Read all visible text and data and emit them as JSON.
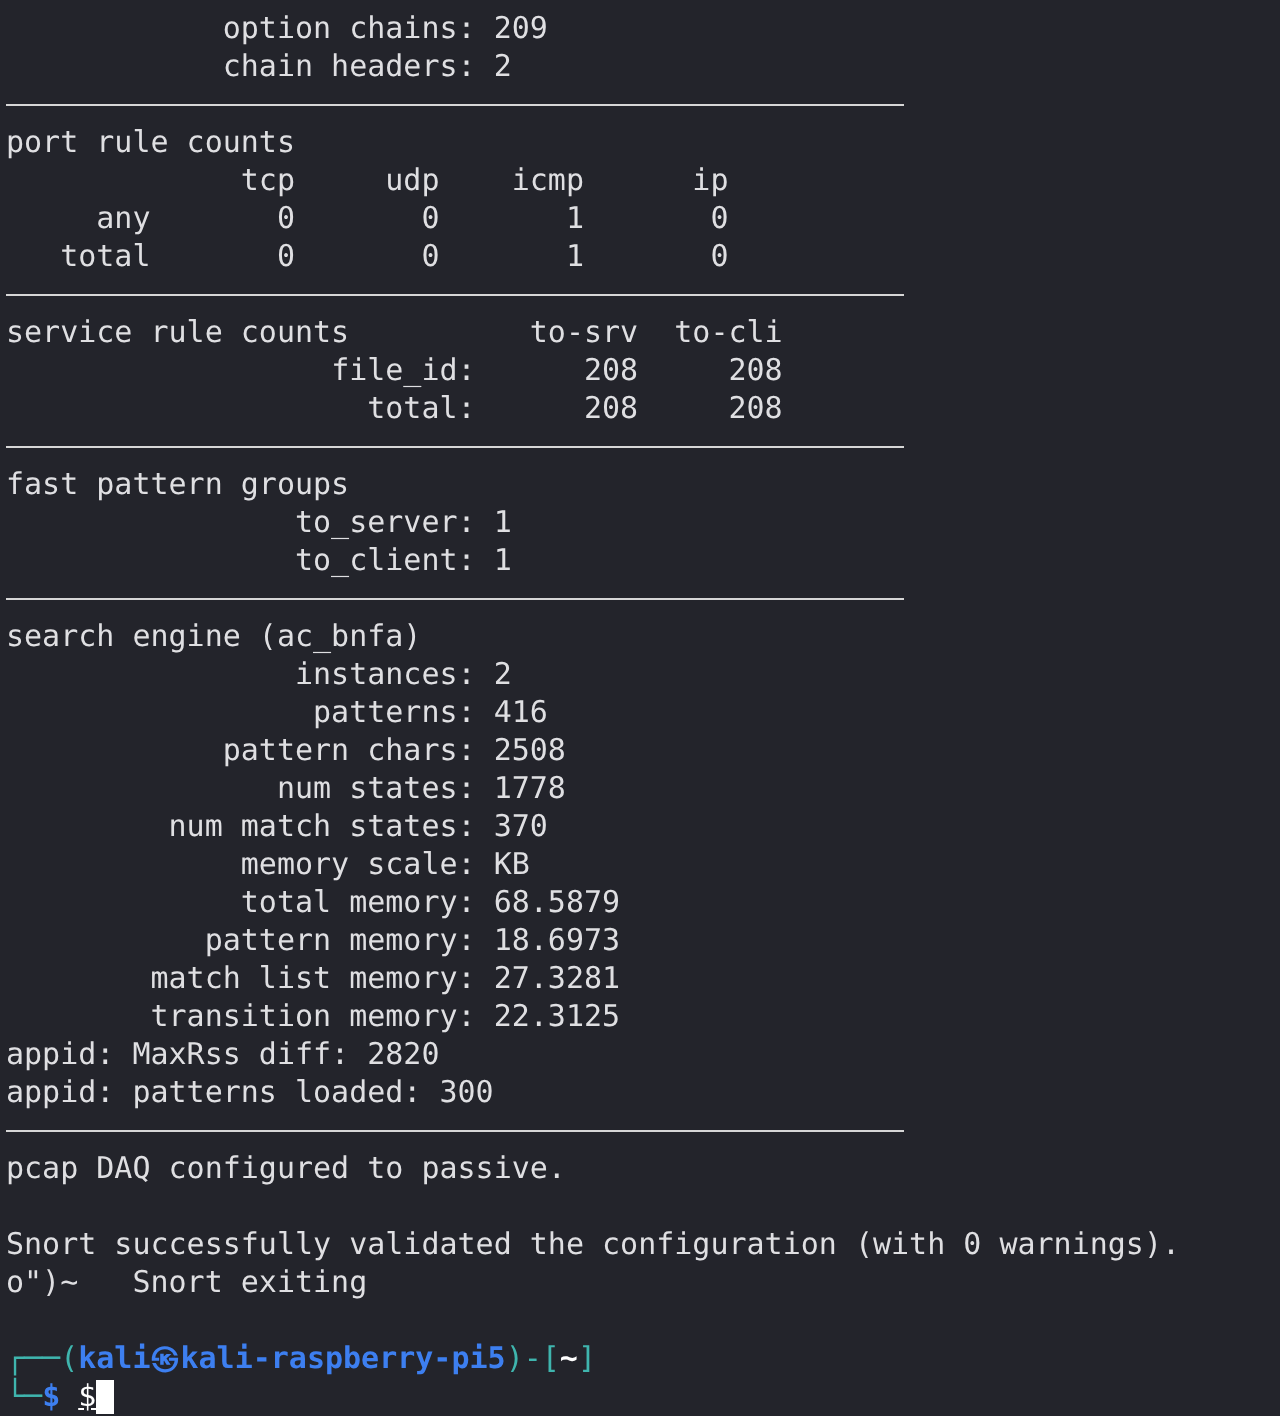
{
  "terminal": {
    "lines": [
      {
        "kind": "text",
        "text": "            option chains: 209"
      },
      {
        "kind": "text",
        "text": "            chain headers: 2"
      },
      {
        "kind": "rule"
      },
      {
        "kind": "text",
        "text": "port rule counts"
      },
      {
        "kind": "text",
        "text": "             tcp     udp    icmp      ip"
      },
      {
        "kind": "text",
        "text": "     any       0       0       1       0"
      },
      {
        "kind": "text",
        "text": "   total       0       0       1       0"
      },
      {
        "kind": "rule"
      },
      {
        "kind": "text",
        "text": "service rule counts          to-srv  to-cli"
      },
      {
        "kind": "text",
        "text": "                  file_id:      208     208"
      },
      {
        "kind": "text",
        "text": "                    total:      208     208"
      },
      {
        "kind": "rule"
      },
      {
        "kind": "text",
        "text": "fast pattern groups"
      },
      {
        "kind": "text",
        "text": "                to_server: 1"
      },
      {
        "kind": "text",
        "text": "                to_client: 1"
      },
      {
        "kind": "rule"
      },
      {
        "kind": "text",
        "text": "search engine (ac_bnfa)"
      },
      {
        "kind": "text",
        "text": "                instances: 2"
      },
      {
        "kind": "text",
        "text": "                 patterns: 416"
      },
      {
        "kind": "text",
        "text": "            pattern chars: 2508"
      },
      {
        "kind": "text",
        "text": "               num states: 1778"
      },
      {
        "kind": "text",
        "text": "         num match states: 370"
      },
      {
        "kind": "text",
        "text": "             memory scale: KB"
      },
      {
        "kind": "text",
        "text": "             total memory: 68.5879"
      },
      {
        "kind": "text",
        "text": "           pattern memory: 18.6973"
      },
      {
        "kind": "text",
        "text": "        match list memory: 27.3281"
      },
      {
        "kind": "text",
        "text": "        transition memory: 22.3125"
      },
      {
        "kind": "text",
        "text": "appid: MaxRss diff: 2820"
      },
      {
        "kind": "text",
        "text": "appid: patterns loaded: 300"
      },
      {
        "kind": "rule"
      },
      {
        "kind": "text",
        "text": "pcap DAQ configured to passive."
      },
      {
        "kind": "blank"
      },
      {
        "kind": "text",
        "text": "Snort successfully validated the configuration (with 0 warnings)."
      },
      {
        "kind": "text",
        "text": "o\")~   Snort exiting"
      },
      {
        "kind": "blank"
      }
    ],
    "prompt": [
      [
        {
          "kind": "frame",
          "text": "┌──("
        },
        {
          "kind": "user",
          "text": "kali㉿kali-raspberry-pi5"
        },
        {
          "kind": "frame",
          "text": ")-["
        },
        {
          "kind": "path",
          "text": "~"
        },
        {
          "kind": "frame",
          "text": "]"
        }
      ],
      [
        {
          "kind": "frame",
          "text": "└─"
        },
        {
          "kind": "user",
          "text": "$"
        },
        {
          "kind": "input",
          "text": "$"
        }
      ]
    ],
    "cursor": true
  }
}
